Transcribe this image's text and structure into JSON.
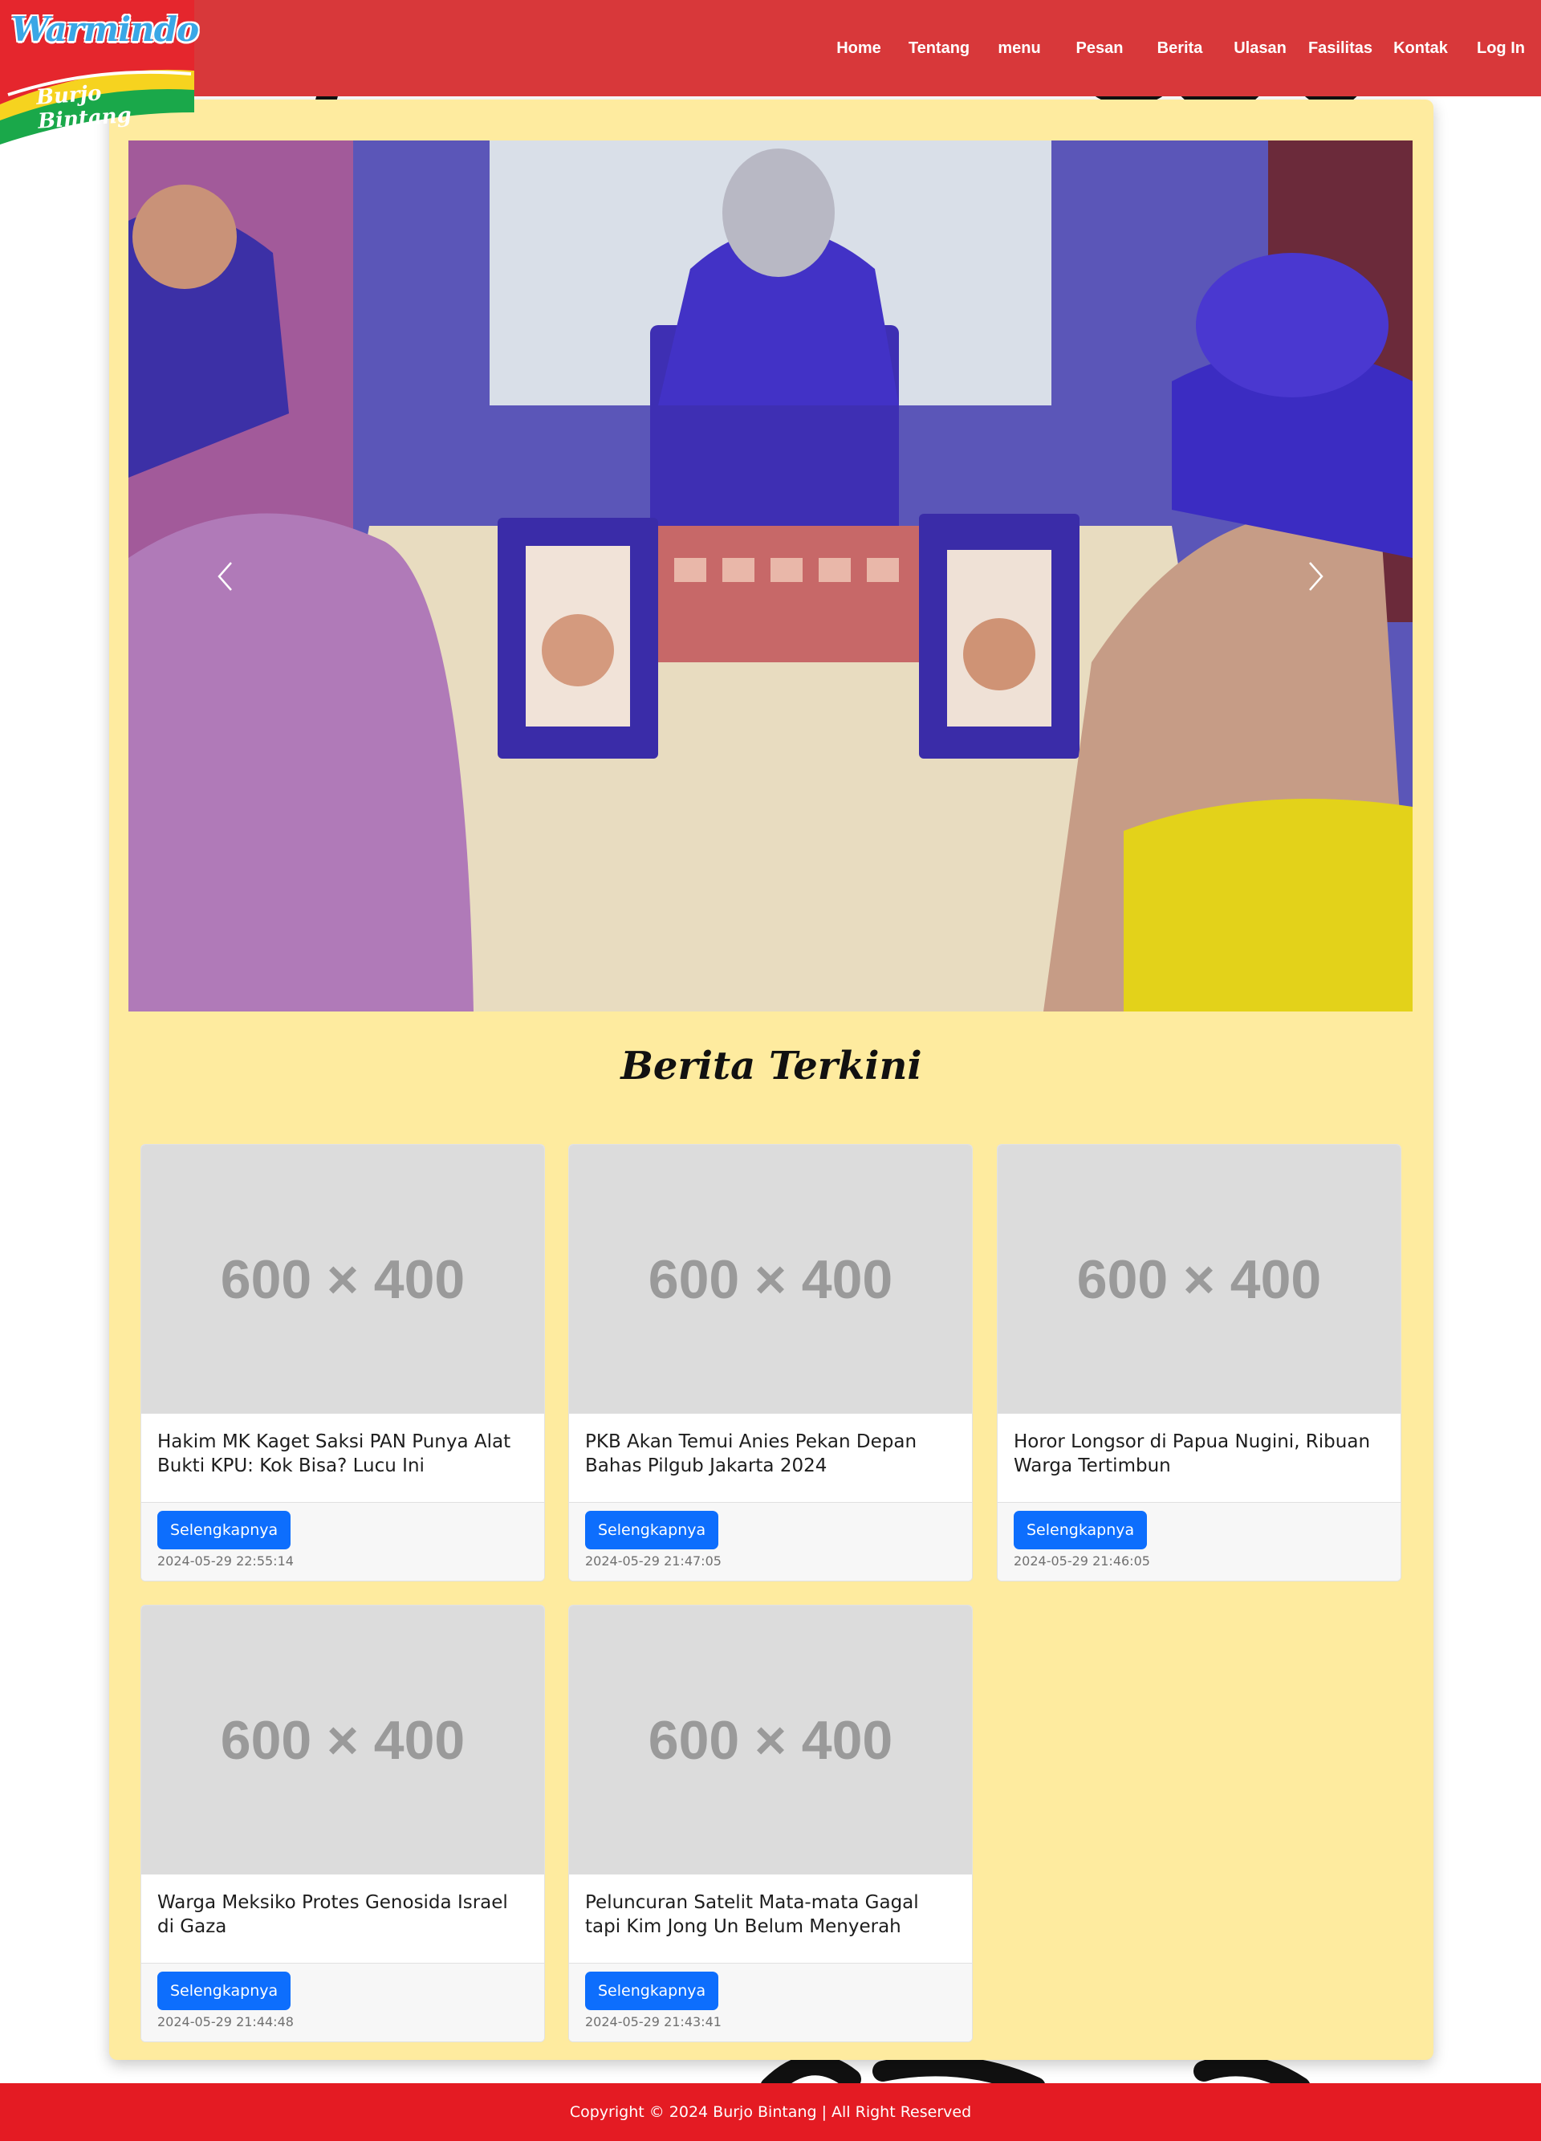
{
  "brand": {
    "name": "Warmindo",
    "tagline": "Burjo Bintang"
  },
  "nav": {
    "items": [
      {
        "label": "Home"
      },
      {
        "label": "Tentang"
      },
      {
        "label": "menu"
      },
      {
        "label": "Pesan"
      },
      {
        "label": "Berita"
      },
      {
        "label": "Ulasan"
      },
      {
        "label": "Fasilitas"
      },
      {
        "label": "Kontak"
      },
      {
        "label": "Log In"
      }
    ]
  },
  "carousel": {
    "prev_icon": "chevron-left-icon",
    "next_icon": "chevron-right-icon"
  },
  "news_section": {
    "title": "Berita Terkini",
    "placeholder_label": "600 × 400",
    "items": [
      {
        "title": "Hakim MK Kaget Saksi PAN Punya Alat Bukti KPU: Kok Bisa? Lucu Ini",
        "button": "Selengkapnya",
        "date": "2024-05-29 22:55:14"
      },
      {
        "title": "PKB Akan Temui Anies Pekan Depan Bahas Pilgub Jakarta 2024",
        "button": "Selengkapnya",
        "date": "2024-05-29 21:47:05"
      },
      {
        "title": "Horor Longsor di Papua Nugini, Ribuan Warga Tertimbun",
        "button": "Selengkapnya",
        "date": "2024-05-29 21:46:05"
      },
      {
        "title": "Warga Meksiko Protes Genosida Israel di Gaza",
        "button": "Selengkapnya",
        "date": "2024-05-29 21:44:48"
      },
      {
        "title": "Peluncuran Satelit Mata-mata Gagal tapi Kim Jong Un Belum Menyerah",
        "button": "Selengkapnya",
        "date": "2024-05-29 21:43:41"
      }
    ]
  },
  "footer": {
    "text": "Copyright © 2024 Burjo Bintang | All Right Reserved"
  },
  "colors": {
    "navbar": "#d8383a",
    "card_bg": "#feeb9f",
    "footer": "#e41b23",
    "button": "#0d6efd"
  }
}
